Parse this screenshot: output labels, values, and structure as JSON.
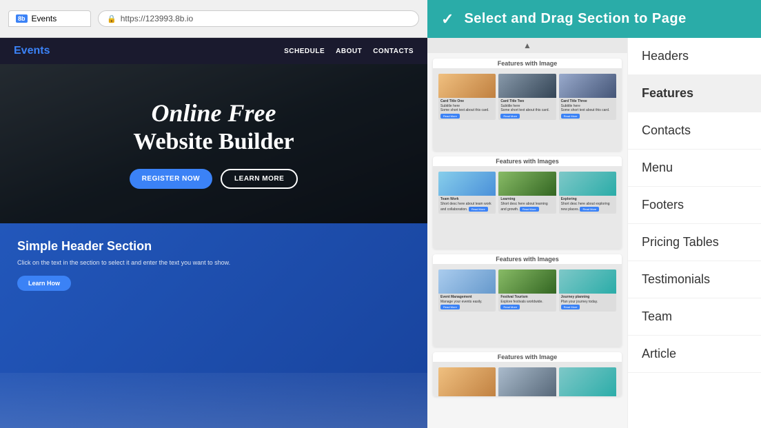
{
  "browser": {
    "tab_favicon": "8b",
    "tab_label": "Events",
    "address_url": "https://123993.8b.io"
  },
  "site": {
    "logo_text": "Events",
    "logo_accent": "E",
    "nav_links": [
      "SCHEDULE",
      "ABOUT",
      "CONTACTS"
    ],
    "hero_title_italic": "Online Free",
    "hero_title_bold": "Website Builder",
    "hero_btn1": "REGISTER NOW",
    "hero_btn2": "LEARN MORE",
    "bottom_title": "Simple Header Section",
    "bottom_desc": "Click on the text in the section to select it and enter the text you want to show.",
    "bottom_btn": "Learn How"
  },
  "header": {
    "check": "✓",
    "title": "Select and  Drag Section to  Page"
  },
  "thumbnails": [
    {
      "title": "Features with Image",
      "cards": [
        {
          "label": "Card Title One",
          "img_type": "warm"
        },
        {
          "label": "Card Title Two",
          "img_type": "dark-img"
        },
        {
          "label": "Card Title Three",
          "img_type": "dark-img"
        }
      ]
    },
    {
      "title": "Features with Images",
      "cards": [
        {
          "label": "Team Work",
          "img_type": "blue"
        },
        {
          "label": "Learning",
          "img_type": "nature"
        },
        {
          "label": "Exploring",
          "img_type": "teal"
        }
      ]
    },
    {
      "title": "Features with Images",
      "cards": [
        {
          "label": "Event Management",
          "img_type": "blue"
        },
        {
          "label": "Festival Tourism",
          "img_type": "nature"
        },
        {
          "label": "Journey planning",
          "img_type": "teal"
        }
      ]
    },
    {
      "title": "Features with Image",
      "cards": [
        {
          "label": "",
          "img_type": "warm"
        },
        {
          "label": "",
          "img_type": "dark-img"
        },
        {
          "label": "",
          "img_type": "teal"
        }
      ]
    }
  ],
  "categories": [
    {
      "label": "Headers",
      "active": false
    },
    {
      "label": "Features",
      "active": true
    },
    {
      "label": "Contacts",
      "active": false
    },
    {
      "label": "Menu",
      "active": false
    },
    {
      "label": "Footers",
      "active": false
    },
    {
      "label": "Pricing Tables",
      "active": false
    },
    {
      "label": "Testimonials",
      "active": false
    },
    {
      "label": "Team",
      "active": false
    },
    {
      "label": "Article",
      "active": false
    }
  ]
}
